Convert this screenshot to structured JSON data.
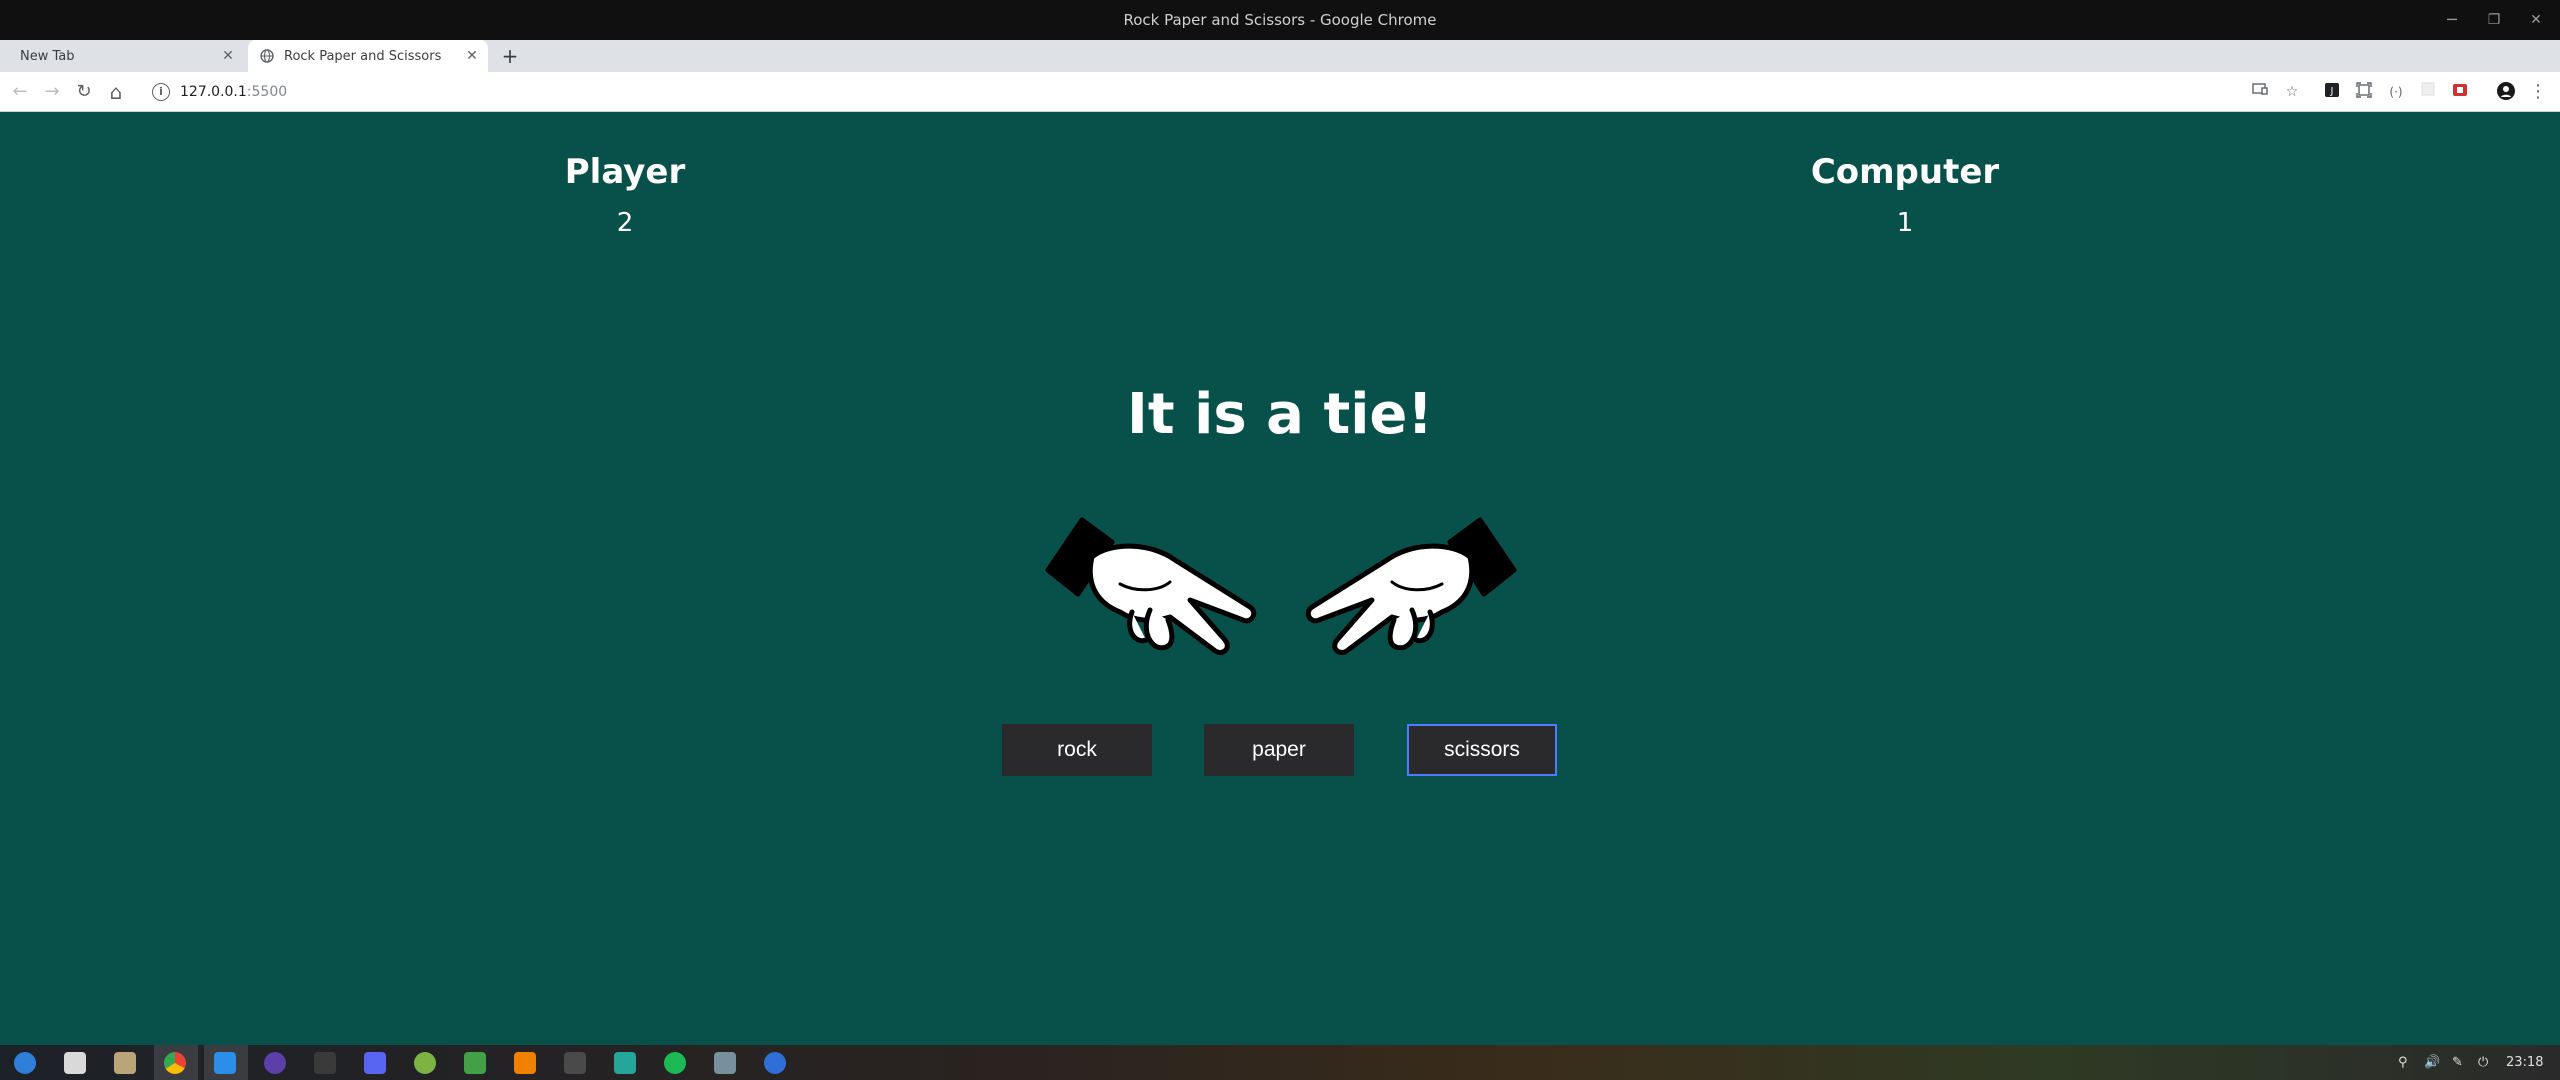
{
  "window": {
    "title": "Rock Paper and Scissors - Google Chrome",
    "minimize": "─",
    "restore": "❐",
    "close": "✕"
  },
  "tabs": [
    {
      "label": "New Tab",
      "close": "✕"
    },
    {
      "label": "Rock Paper and Scissors",
      "close": "✕"
    }
  ],
  "newtab_label": "+",
  "toolbar": {
    "back": "←",
    "forward": "→",
    "reload": "↻",
    "home": "⌂",
    "info": "i",
    "url_host": "127.0.0.1",
    "url_port": ":5500",
    "menu": "⋮"
  },
  "game": {
    "player_label": "Player",
    "player_score": "2",
    "computer_label": "Computer",
    "computer_score": "1",
    "result": "It is a tie!",
    "player_choice_icon": "scissors-hand-icon",
    "computer_choice_icon": "scissors-hand-icon",
    "buttons": [
      "rock",
      "paper",
      "scissors"
    ]
  },
  "taskbar": {
    "clock": "23:18",
    "apps": [
      "launcher-icon",
      "files-icon",
      "file-manager-icon",
      "chrome-icon",
      "vscode-icon",
      "firefox-icon",
      "terminal-icon",
      "discord-icon",
      "android-studio-icon",
      "folder-icon",
      "vlc-icon",
      "sound-icon",
      "tool-icon",
      "spotify-icon",
      "stack-icon",
      "qbittorrent-icon"
    ],
    "colors": {
      "chrome": "#4285f4",
      "vscode": "#2b8ee8",
      "spotify": "#1db954",
      "vlc": "#f08000"
    }
  },
  "colors": {
    "page_background": "#08504a",
    "button_background": "#2a2a2d",
    "focus_outline": "#4d7cff"
  }
}
